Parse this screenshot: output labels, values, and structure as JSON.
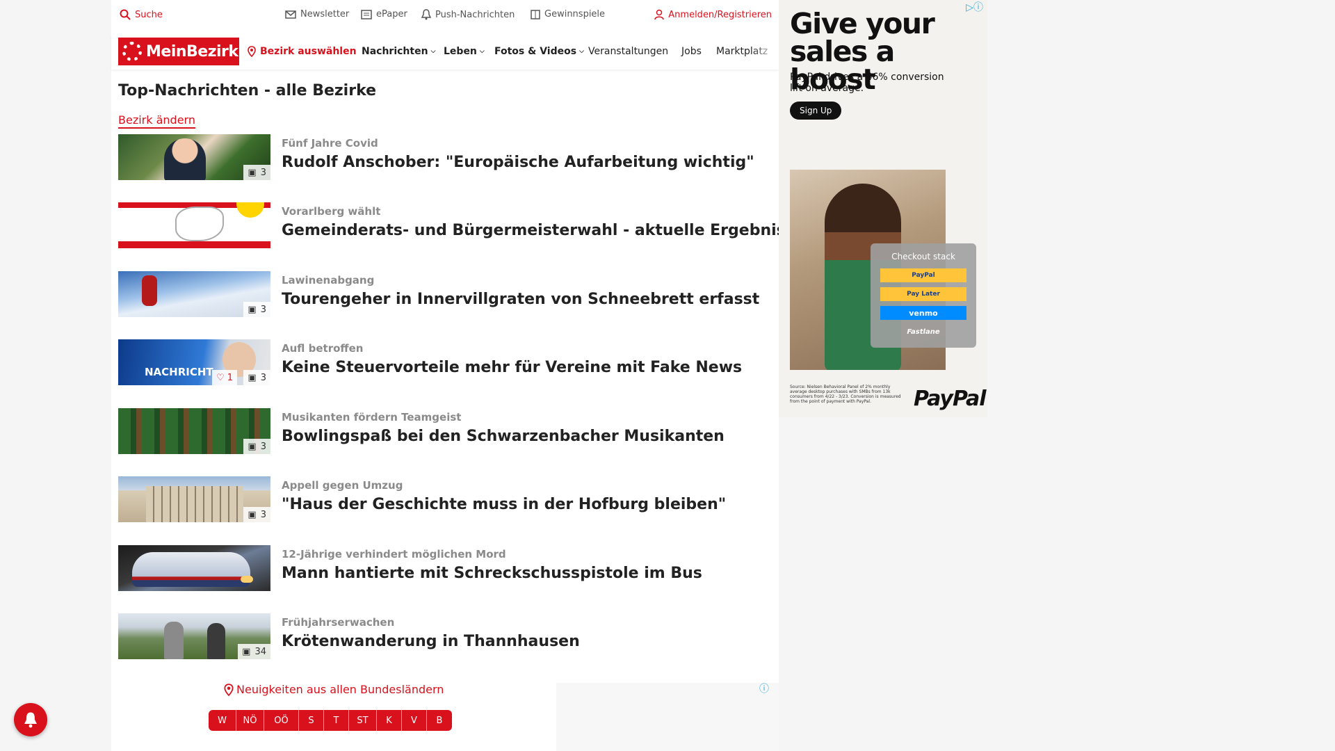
{
  "util": {
    "search": "Suche",
    "newsletter": "Newsletter",
    "epaper": "ePaper",
    "push": "Push-Nachrichten",
    "gewinnspiele": "Gewinnspiele",
    "login": "Anmelden/Registrieren"
  },
  "nav": {
    "logo": "MeinBezirk",
    "bezirk": "Bezirk auswählen",
    "items": [
      "Nachrichten",
      "Leben",
      "Fotos & Videos",
      "Veranstaltungen",
      "Jobs",
      "Marktplatz"
    ]
  },
  "main": {
    "title": "Top-Nachrichten - alle Bezirke",
    "change_link": "Bezirk ändern"
  },
  "articles": [
    {
      "kicker": "Fünf Jahre Covid",
      "headline": "Rudolf Anschober: \"Europäische Aufarbeitung wichtig\"",
      "images": "3"
    },
    {
      "kicker": "Vorarlberg wählt",
      "headline": "Gemeinderats- und Bürgermeisterwahl - aktuelle Ergebnisse",
      "images": ""
    },
    {
      "kicker": "Lawinenabgang",
      "headline": "Tourengeher in Innervillgraten von Schneebrett erfasst",
      "images": "3"
    },
    {
      "kicker": "Aufl betroffen",
      "headline": "Keine Steuervorteile mehr für Vereine mit Fake News",
      "images": "3",
      "likes": "1",
      "overlay_text": "NACHRICHT"
    },
    {
      "kicker": "Musikanten fördern Teamgeist",
      "headline": "Bowlingspaß bei den Schwarzenbacher Musikanten",
      "images": "3"
    },
    {
      "kicker": "Appell gegen Umzug",
      "headline": "\"Haus der Geschichte muss in der Hofburg bleiben\"",
      "images": "3"
    },
    {
      "kicker": "12-Jährige verhindert möglichen Mord",
      "headline": "Mann hantierte mit Schreckschusspistole im Bus",
      "images": ""
    },
    {
      "kicker": "Frühjahrserwachen",
      "headline": "Krötenwanderung in Thannhausen",
      "images": "34"
    }
  ],
  "bottom": {
    "news_all": "Neuigkeiten aus allen Bundesländern",
    "states": [
      "W",
      "NÖ",
      "OÖ",
      "S",
      "T",
      "ST",
      "K",
      "V",
      "B"
    ]
  },
  "ad": {
    "headline_1": "Give your",
    "headline_2": "sales a boost",
    "sub": "PayPal drives a 46% conversion lift on average.",
    "button": "Sign Up",
    "card_title": "Checkout stack",
    "pay_options": [
      "PayPal",
      "Pay Later",
      "venmo",
      "Fastlane"
    ],
    "source": "Source: Nielsen Behavioral Panel of 2% monthly average desktop purchases with SMBs from 13k consumers from 4/22 - 3/23. Conversion is measured from the point of payment with PayPal.",
    "logo": "PayPal"
  },
  "colors": {
    "brand_red": "#d9111c",
    "ad_info_blue": "#2aa8d8"
  }
}
